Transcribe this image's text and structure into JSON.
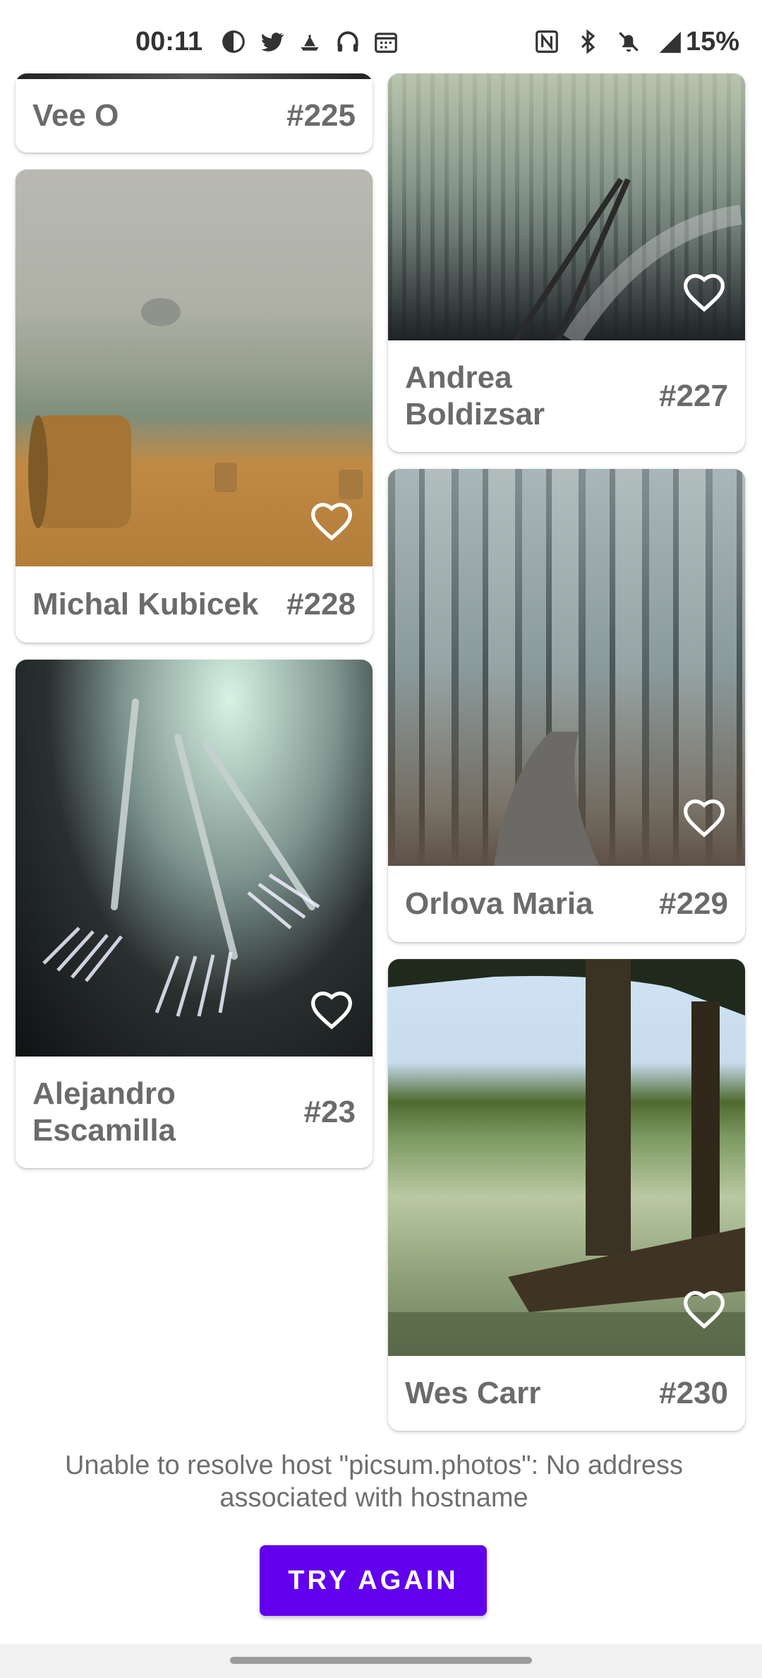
{
  "status_bar": {
    "time": "00:11",
    "battery": "15%",
    "icons_left": [
      "pie-chart-icon",
      "twitter-icon",
      "boat-icon",
      "headphones-icon",
      "calendar-icon"
    ],
    "icons_right": [
      "nfc-icon",
      "bluetooth-icon",
      "mute-bell-icon",
      "signal-icon"
    ]
  },
  "cards": [
    {
      "author": "Vee O",
      "id": "#225"
    },
    {
      "author": "Andrea\nBoldizsar",
      "id": "#227"
    },
    {
      "author": "Michal Kubicek",
      "id": "#228"
    },
    {
      "author": "Orlova Maria",
      "id": "#229"
    },
    {
      "author": "Alejandro\nEscamilla",
      "id": "#23"
    },
    {
      "author": "Wes Carr",
      "id": "#230"
    }
  ],
  "error": {
    "message": "Unable to resolve host \"picsum.photos\": No address associated with hostname",
    "button": "TRY AGAIN"
  },
  "colors": {
    "accent": "#6200ee"
  }
}
